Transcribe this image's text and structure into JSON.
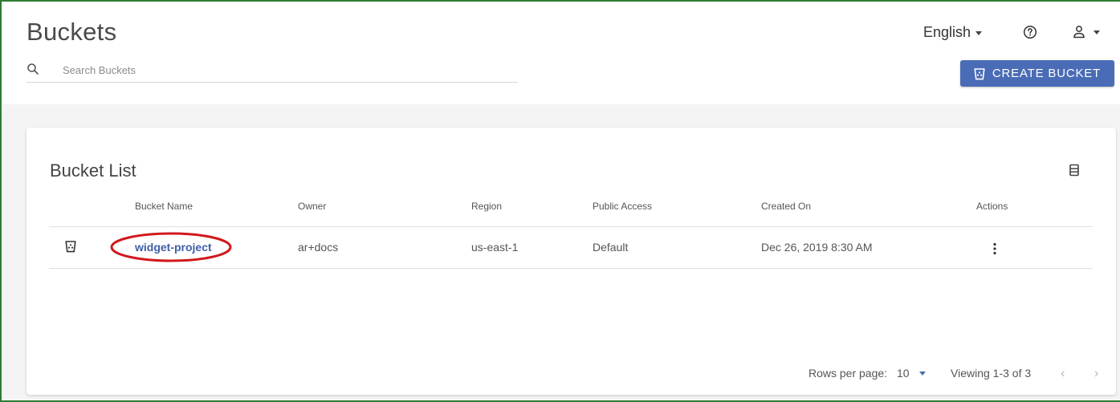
{
  "header": {
    "title": "Buckets",
    "search_placeholder": "Search Buckets",
    "language": "English",
    "create_button_label": "CREATE BUCKET"
  },
  "card": {
    "title": "Bucket List",
    "columns": [
      "Bucket Name",
      "Owner",
      "Region",
      "Public Access",
      "Created On",
      "Actions"
    ],
    "rows": [
      {
        "name": "widget-project",
        "owner": "ar+docs",
        "region": "us-east-1",
        "public_access": "Default",
        "created_on": "Dec 26, 2019 8:30 AM"
      }
    ]
  },
  "pagination": {
    "rows_per_page_label": "Rows per page:",
    "rows_per_page_value": "10",
    "viewing_text": "Viewing 1-3 of 3",
    "prev_symbol": "‹",
    "next_symbol": "›"
  },
  "icons": {
    "search": "search-icon",
    "help": "help-circle-icon",
    "user": "user-icon",
    "bucket": "bucket-icon",
    "columns": "columns-icon",
    "kebab": "kebab-menu-icon"
  },
  "colors": {
    "accent": "#4a6cb6",
    "link": "#3f5ea8",
    "highlight": "#d0191c",
    "frame_border": "#2e7d32"
  }
}
